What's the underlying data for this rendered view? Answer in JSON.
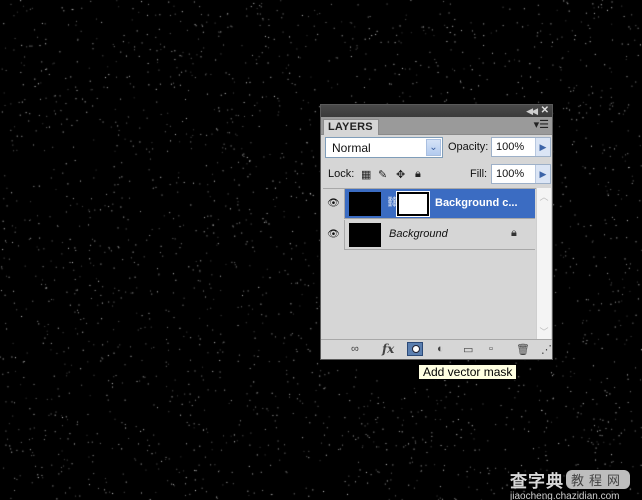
{
  "panel": {
    "title_controls": {
      "collapse_icon": "double-chevron-left-icon",
      "close_icon": "close-icon"
    },
    "tab_label": "LAYERS",
    "panel_menu_icon": "panel-menu-icon",
    "blend_mode": "Normal",
    "opacity_label": "Opacity:",
    "opacity_value": "100%",
    "lock_label": "Lock:",
    "lock_icons": [
      "lock-transparent-pixels-icon",
      "lock-image-pixels-icon",
      "lock-position-icon",
      "lock-all-icon"
    ],
    "fill_label": "Fill:",
    "fill_value": "100%",
    "layers": [
      {
        "name": "Background c...",
        "selected": true,
        "visible": true,
        "has_vector_mask": true,
        "locked": false
      },
      {
        "name": "Background",
        "selected": false,
        "visible": true,
        "has_vector_mask": false,
        "locked": true
      }
    ],
    "footer_buttons": [
      "link-layers-icon",
      "add-layer-style-icon",
      "add-vector-mask-icon",
      "new-adjustment-layer-icon",
      "new-group-icon",
      "new-layer-icon",
      "delete-layer-icon"
    ],
    "fx_label": "fx"
  },
  "tooltip": "Add vector mask",
  "watermark": {
    "brand": "查字典",
    "tag": "教程网",
    "url": "jiaocheng.chazidian.com"
  }
}
